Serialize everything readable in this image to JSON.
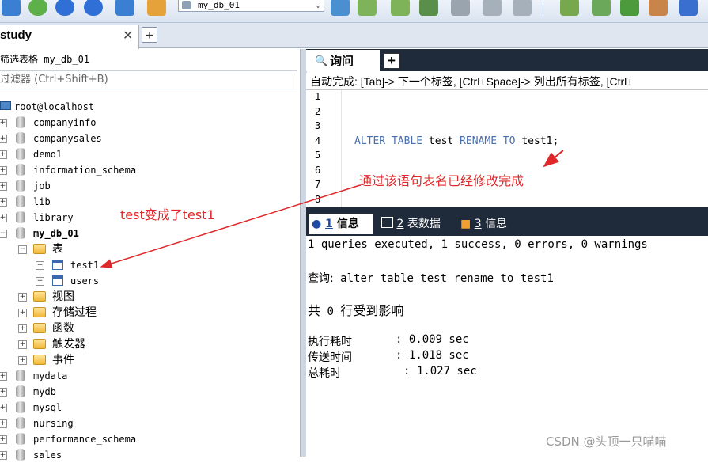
{
  "toolbar": {
    "db_selector_value": "my_db_01"
  },
  "connection": {
    "tab_label": "study"
  },
  "filter": {
    "label": "筛选表格 my_db_01",
    "placeholder": "过滤器 (Ctrl+Shift+B)"
  },
  "tree": {
    "root": "root@localhost",
    "databases_before": [
      "companyinfo",
      "companysales",
      "demo1",
      "information_schema",
      "job",
      "lib",
      "library"
    ],
    "active_db": "my_db_01",
    "tables_folder": "表",
    "tables": [
      "test1",
      "users"
    ],
    "folders": [
      "视图",
      "存储过程",
      "函数",
      "触发器",
      "事件"
    ],
    "databases_after": [
      "mydata",
      "mydb",
      "mysql",
      "nursing",
      "performance_schema",
      "sales"
    ]
  },
  "editor": {
    "tab_label": "询问",
    "autocomplete": "自动完成: [Tab]-> 下一个标签, [Ctrl+Space]-> 列出所有标签, [Ctrl+",
    "line_numbers": [
      "1",
      "2",
      "3",
      "4",
      "5",
      "6",
      "7",
      "8"
    ],
    "code": {
      "kw1": "ALTER TABLE",
      "ident1": "test",
      "kw2": "RENAME TO",
      "ident2": "test1;"
    }
  },
  "annotations": {
    "editor_note": "通过该语句表名已经修改完成",
    "tree_note": "test变成了test1",
    "color": "#e0282a"
  },
  "results": {
    "tabs": [
      {
        "num": "1",
        "label": "信息"
      },
      {
        "num": "2",
        "label": "表数据"
      },
      {
        "num": "3",
        "label": "信息"
      }
    ],
    "summary": "1 queries executed, 1 success, 0 errors, 0 warnings",
    "query_label": "查询:",
    "query_text": "alter table test rename to test1",
    "affected_prefix": "共",
    "affected_count": "0",
    "affected_suffix": "行受到影响",
    "exec_time_label": "执行耗时",
    "exec_time_value": ": 0.009 sec",
    "transfer_time_label": "传送时间",
    "transfer_time_value": ": 1.018 sec",
    "total_time_label": "总耗时",
    "total_time_value": ": 1.027 sec"
  },
  "watermark": "CSDN @头顶一只喵喵"
}
